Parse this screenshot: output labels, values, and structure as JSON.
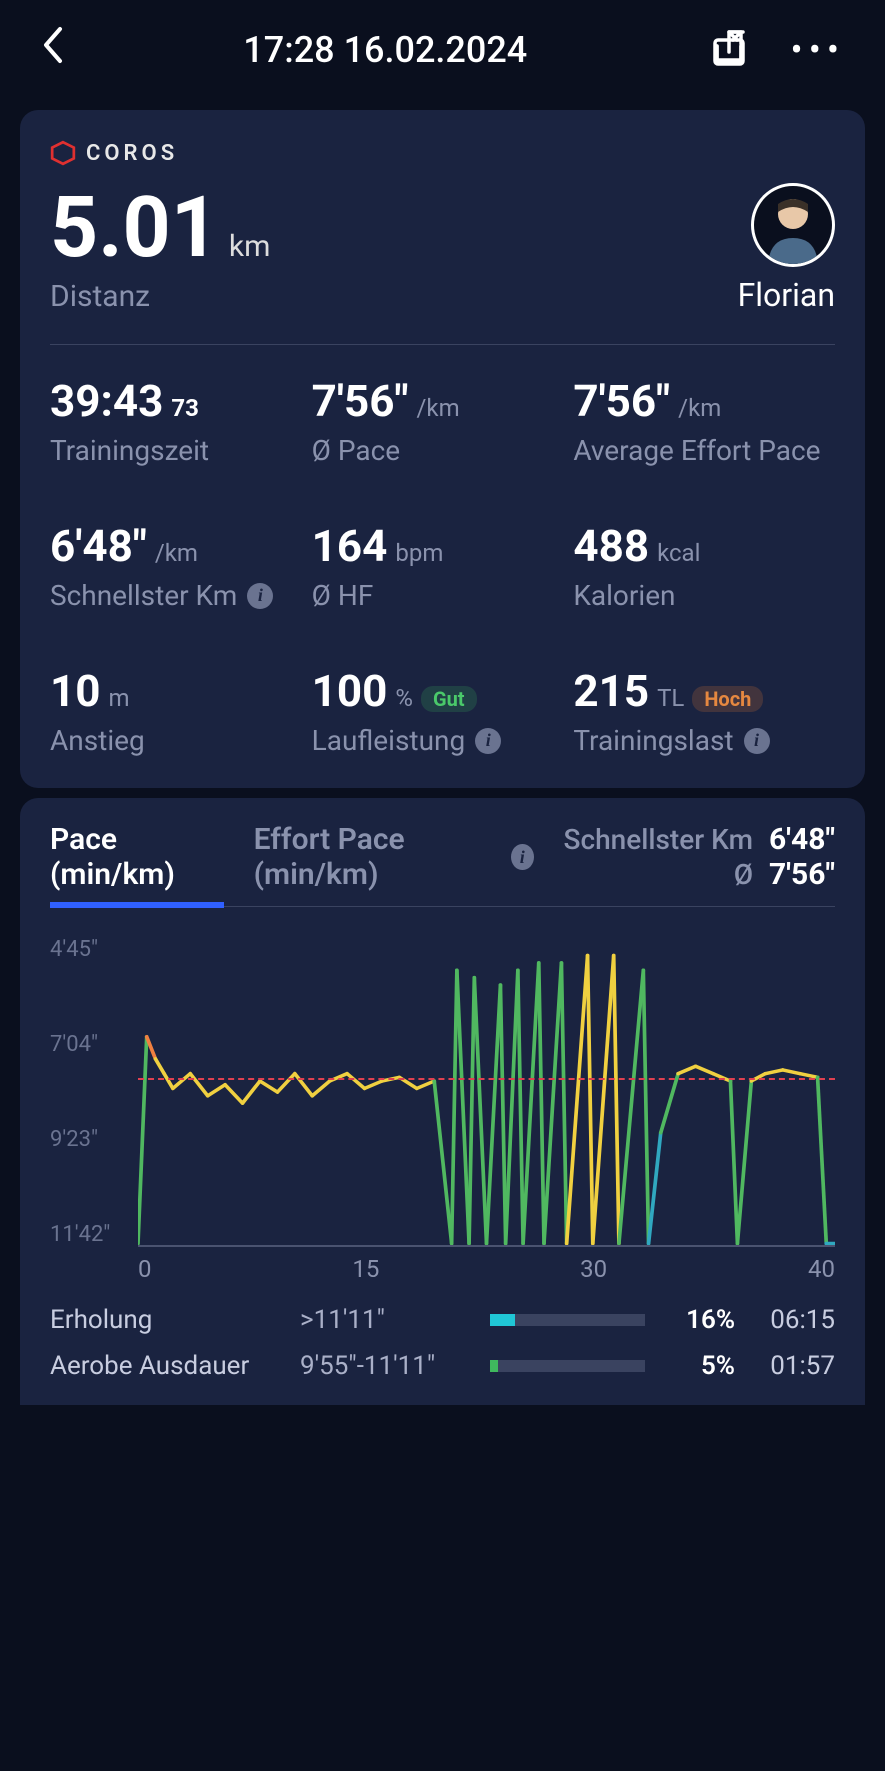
{
  "header": {
    "title": "17:28 16.02.2024"
  },
  "brand": "COROS",
  "colors": {
    "accent": "#3060ff",
    "good": "#4ac96a",
    "high": "#e68840",
    "recovery": "#20c6d6",
    "aerobic": "#3fb85e"
  },
  "summary": {
    "distance_value": "5.01",
    "distance_unit": "km",
    "distance_label": "Distanz",
    "user_name": "Florian"
  },
  "stats": [
    {
      "value": "39:43",
      "sup": "73",
      "unit": "",
      "label": "Trainingszeit"
    },
    {
      "value": "7'56\"",
      "unit": "/km",
      "label": "Ø Pace"
    },
    {
      "value": "7'56\"",
      "unit": "/km",
      "label": "Average Effort Pace"
    },
    {
      "value": "6'48\"",
      "unit": "/km",
      "label": "Schnellster Km",
      "info": true
    },
    {
      "value": "164",
      "unit": "bpm",
      "label": "Ø HF"
    },
    {
      "value": "488",
      "unit": "kcal",
      "label": "Kalorien"
    },
    {
      "value": "10",
      "unit": "m",
      "label": "Anstieg"
    },
    {
      "value": "100",
      "unit": "%",
      "label": "Laufleistung",
      "badge": "Gut",
      "badge_class": "badge-good",
      "info": true
    },
    {
      "value": "215",
      "unit": "TL",
      "label": "Trainingslast",
      "badge": "Hoch",
      "badge_class": "badge-high",
      "info": true
    }
  ],
  "chart_section": {
    "tab_active": "Pace (min/km)",
    "tab_other": "Effort Pace (min/km)",
    "fastest_label": "Schnellster Km",
    "fastest_value": "6'48\"",
    "avg_label": "Ø",
    "avg_value": "7'56\""
  },
  "chart_data": {
    "type": "line",
    "xlabel": "min",
    "ylabel": "Pace",
    "x_ticks": [
      "0",
      "15",
      "30",
      "40"
    ],
    "y_ticks": [
      "4'45\"",
      "7'04\"",
      "9'23\"",
      "11'42\""
    ],
    "x_range": [
      0,
      40
    ],
    "y_range_sec": [
      285,
      702
    ],
    "avg_line_sec": 476,
    "series": [
      {
        "name": "Pace",
        "x": [
          0,
          0.5,
          1,
          1.5,
          2,
          3,
          4,
          5,
          6,
          7,
          8,
          9,
          10,
          11,
          12,
          13,
          14,
          15,
          16,
          17,
          18,
          18.3,
          19,
          19.3,
          20,
          20.8,
          21.1,
          21.8,
          22.1,
          23,
          23.3,
          24.3,
          24.6,
          25.8,
          26.1,
          27.3,
          27.6,
          29,
          29.3,
          30,
          31,
          32,
          33,
          34,
          34.4,
          35.2,
          36,
          37,
          38,
          39,
          39.5,
          40
        ],
        "y_sec": [
          700,
          420,
          450,
          470,
          490,
          470,
          500,
          485,
          510,
          480,
          495,
          470,
          500,
          480,
          470,
          490,
          480,
          475,
          490,
          480,
          700,
          330,
          700,
          340,
          700,
          350,
          700,
          330,
          700,
          320,
          700,
          320,
          700,
          310,
          700,
          310,
          700,
          330,
          700,
          550,
          470,
          460,
          470,
          480,
          700,
          480,
          470,
          465,
          470,
          475,
          700,
          700
        ]
      }
    ]
  },
  "zones": [
    {
      "name": "Erholung",
      "range": ">11'11\"",
      "pct": 16,
      "time": "06:15",
      "color": "#20c6d6"
    },
    {
      "name": "Aerobe Ausdauer",
      "range": "9'55\"-11'11\"",
      "pct": 5,
      "time": "01:57",
      "color": "#3fb85e"
    }
  ]
}
